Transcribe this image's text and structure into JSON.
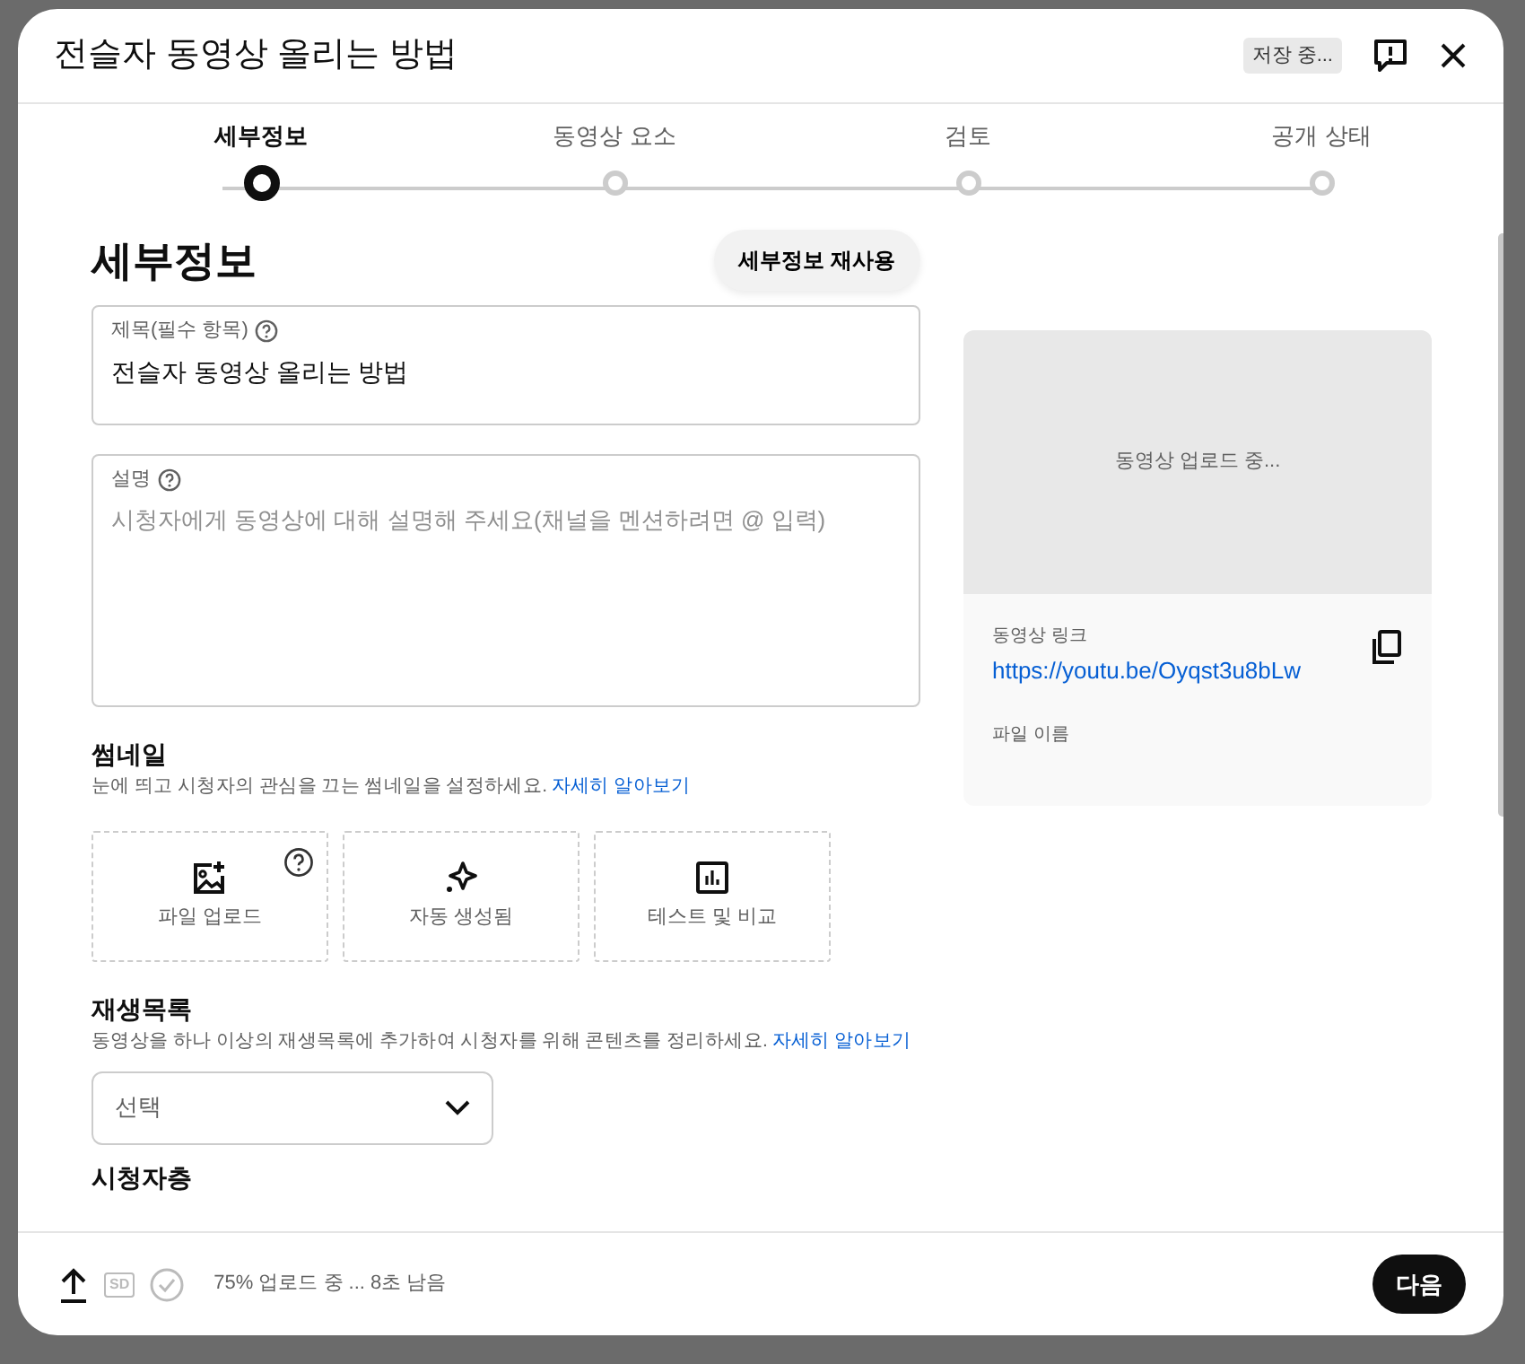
{
  "dialog": {
    "title": "전슬자 동영상 올리는 방법",
    "saving_badge": "저장 중..."
  },
  "steps": [
    {
      "label": "세부정보",
      "selected": true
    },
    {
      "label": "동영상 요소",
      "selected": false
    },
    {
      "label": "검토",
      "selected": false
    },
    {
      "label": "공개 상태",
      "selected": false
    }
  ],
  "section_title": "세부정보",
  "reuse_button": "세부정보 재사용",
  "title_field": {
    "label": "제목(필수 항목)",
    "value": "전슬자 동영상 올리는 방법"
  },
  "description_field": {
    "label": "설명",
    "placeholder": "시청자에게 동영상에 대해 설명해 주세요(채널을 멘션하려면 @ 입력)"
  },
  "thumbnail": {
    "heading": "썸네일",
    "description": "눈에 띄고 시청자의 관심을 끄는 썸네일을 설정하세요.",
    "link": "자세히 알아보기",
    "options": [
      {
        "kind": "upload",
        "label": "파일 업로드",
        "help": true
      },
      {
        "kind": "auto",
        "label": "자동 생성됨",
        "help": false
      },
      {
        "kind": "test",
        "label": "테스트 및 비교",
        "help": false
      }
    ]
  },
  "playlist": {
    "heading": "재생목록",
    "description": "동영상을 하나 이상의 재생목록에 추가하여 시청자를 위해 콘텐츠를 정리하세요.",
    "link": "자세히 알아보기",
    "select": {
      "placeholder": "선택"
    }
  },
  "audience": {
    "heading": "시청자층"
  },
  "preview": {
    "status": "동영상 업로드 중...",
    "link_label": "동영상 링크",
    "link": "https://youtu.be/Oyqst3u8bLw",
    "file_label": "파일 이름"
  },
  "footer": {
    "quality_badge": "SD",
    "status": "75% 업로드 중 ... 8초 남음",
    "next_button": "다음"
  }
}
